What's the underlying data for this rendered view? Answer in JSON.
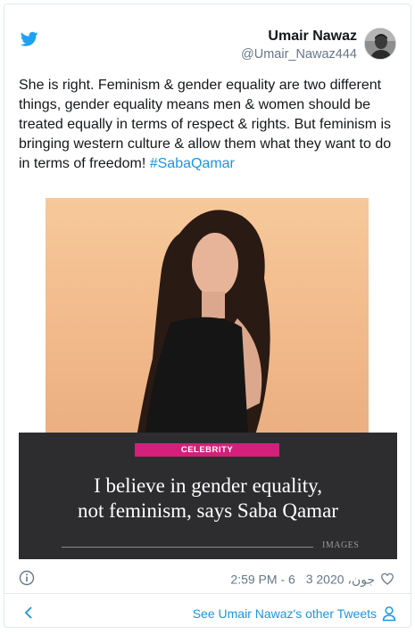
{
  "tweet": {
    "author_name": "Umair Nawaz",
    "author_handle": "@Umair_Nawaz444",
    "text": "She is right. Feminism & gender equality are two different things, gender equality means men & women should be treated equally in terms of respect & rights. But feminism is bringing western culture & allow them what they want to do in terms of freedom! ",
    "hashtag": "#SabaQamar"
  },
  "media": {
    "category": "CELEBRITY",
    "headline_line1": "I believe in gender equality,",
    "headline_line2": "not feminism, says Saba Qamar",
    "watermark": "IMAGES"
  },
  "footer": {
    "timestamp": "2:59 PM - 6 جون، 2020",
    "likes": "3",
    "other_tweets_label": "See Umair Nawaz's other Tweets"
  },
  "colors": {
    "twitter_blue": "#1da1f2",
    "link_blue": "#1b95e0",
    "category_pink": "#d4207a",
    "panel_dark": "#2d2d2f"
  },
  "icons": [
    "twitter-bird-icon",
    "info-icon",
    "heart-icon",
    "chevron-left-icon",
    "person-icon"
  ]
}
